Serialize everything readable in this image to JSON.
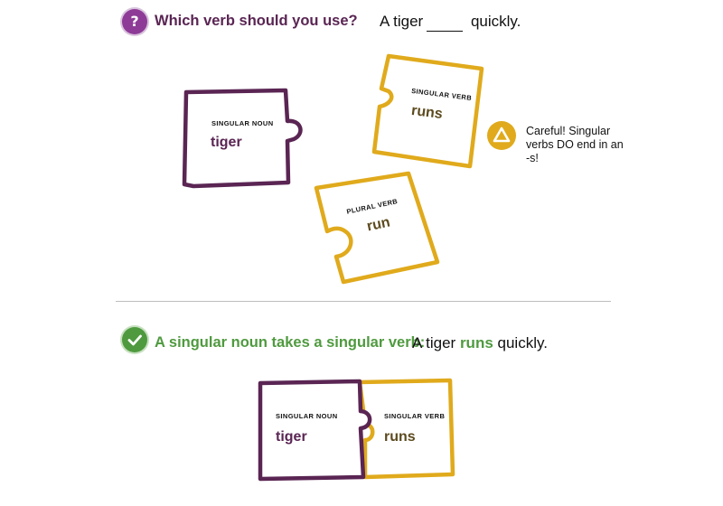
{
  "question": {
    "icon": "question-icon",
    "text": "Which verb should you use?",
    "sentence_start": "A tiger",
    "sentence_end": "quickly."
  },
  "pieces": {
    "noun": {
      "label": "SINGULAR  NOUN",
      "word": "tiger"
    },
    "singular_verb": {
      "label": "SINGULAR VERB",
      "word": "runs"
    },
    "plural_verb": {
      "label": "PLURAL VERB",
      "word": "run"
    }
  },
  "warning": {
    "icon": "warning-triangle-icon",
    "text": "Careful!  Singular verbs DO end in an -s!"
  },
  "answer": {
    "icon": "check-icon",
    "label": "A singular noun takes a singular verb:",
    "sentence_start": "A tiger",
    "verb": "runs",
    "sentence_end": "quickly."
  },
  "result_pieces": {
    "noun": {
      "label": "SINGULAR NOUN",
      "word": "tiger"
    },
    "verb": {
      "label": "SINGULAR VERB",
      "word": "runs"
    }
  },
  "colors": {
    "purple": "#5a2553",
    "gold": "#e0aa1c",
    "green": "#4f9a3f",
    "verb_text": "#5c4a1e"
  }
}
